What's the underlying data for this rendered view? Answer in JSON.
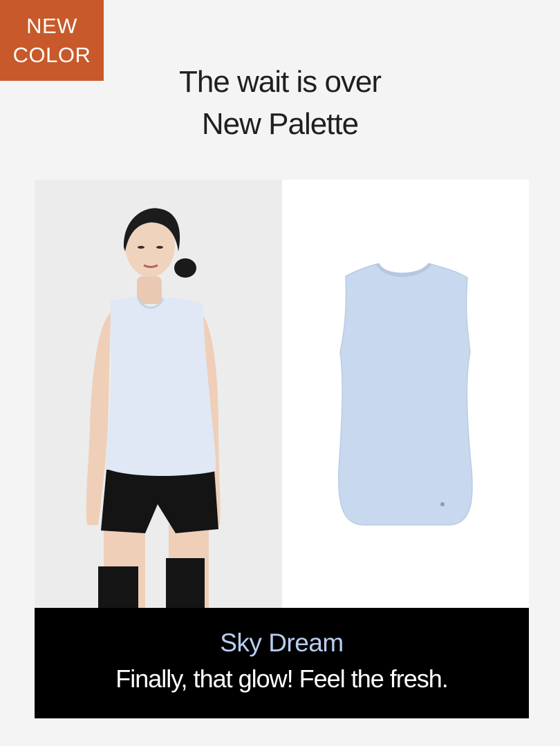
{
  "badge": {
    "line1": "NEW",
    "line2": "COLOR"
  },
  "headline": {
    "line1": "The wait is over",
    "line2": "New Palette"
  },
  "product": {
    "color_name": "Sky Dream",
    "tagline": "Finally, that glow! Feel the fresh.",
    "model_image": "model-wearing-tank-top",
    "flat_image": "tank-top-flat-lay"
  },
  "colors": {
    "badge_bg": "#c8592a",
    "tank_blue": "#c9d8ec",
    "color_name_text": "#b9cdf0",
    "caption_bg": "#000000"
  }
}
